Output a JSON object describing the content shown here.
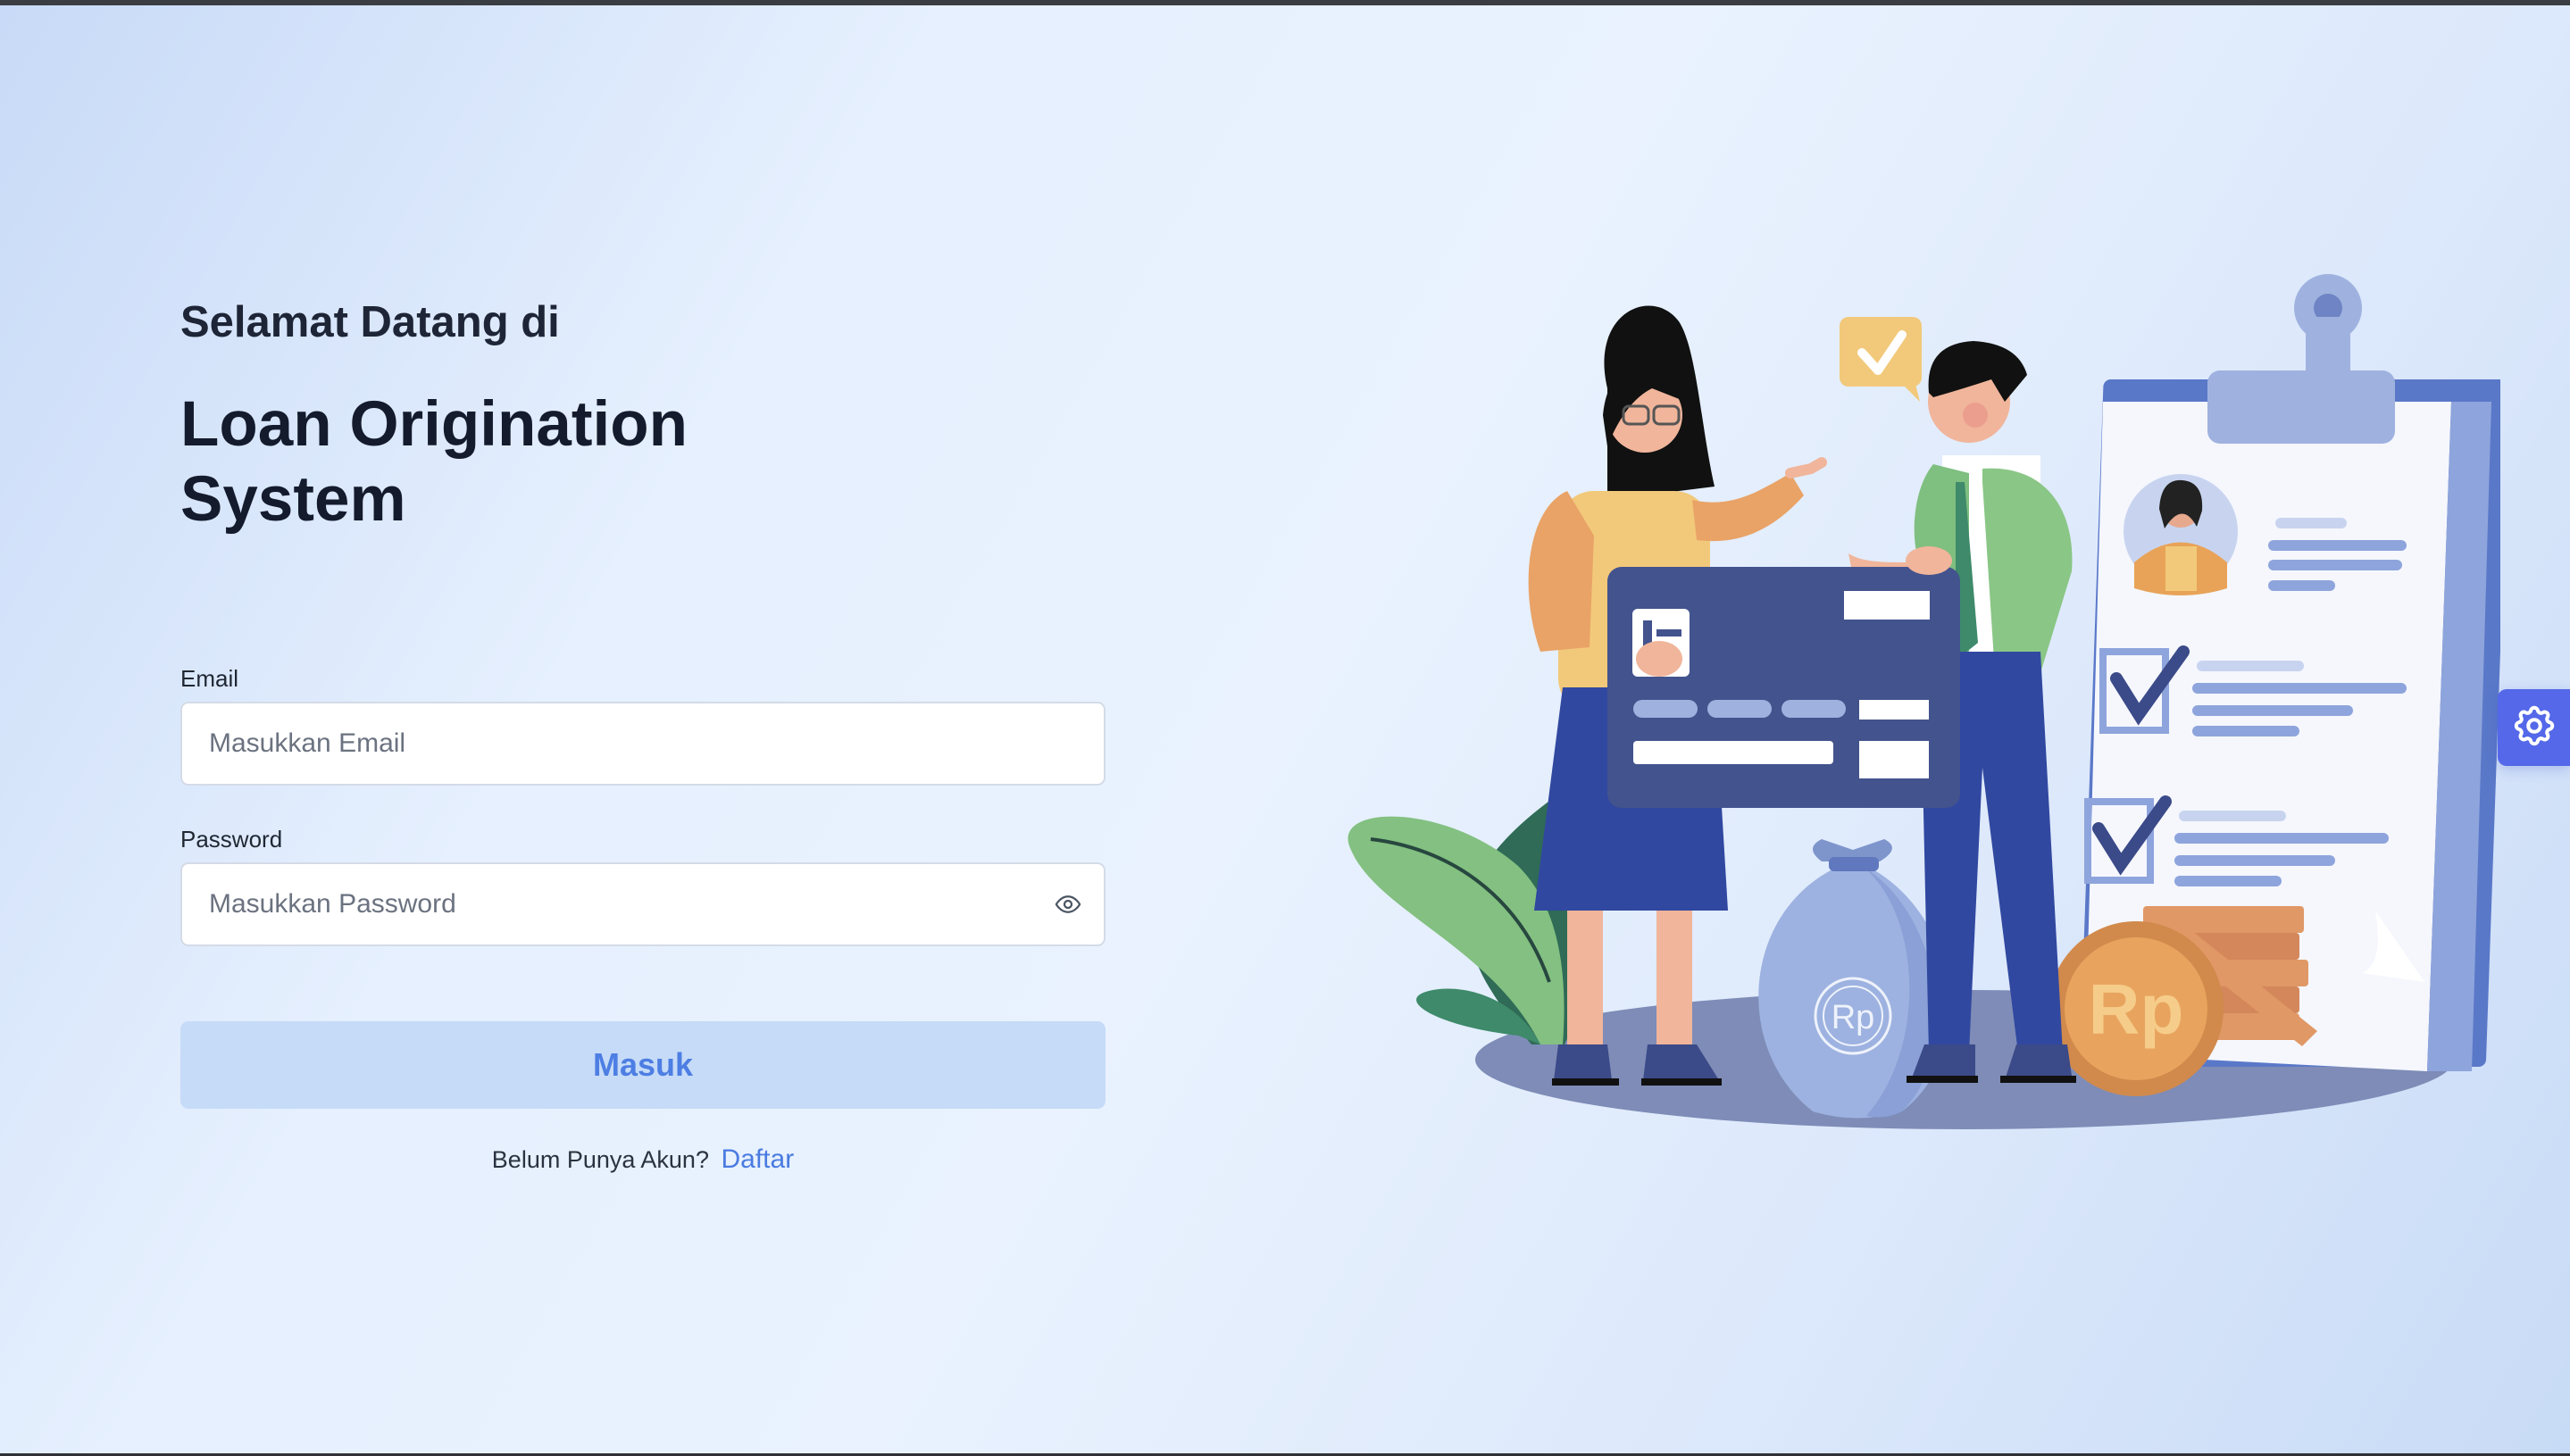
{
  "login": {
    "greeting": "Selamat Datang di",
    "title": "Loan Origination System",
    "email": {
      "label": "Email",
      "placeholder": "Masukkan Email",
      "value": ""
    },
    "password": {
      "label": "Password",
      "placeholder": "Masukkan Password",
      "value": "",
      "toggle_icon": "eye-icon"
    },
    "submit_label": "Masuk",
    "register_prompt": "Belum Punya Akun?",
    "register_link": "Daftar"
  },
  "illustration": {
    "currency_text": "Rp"
  },
  "settings": {
    "icon": "gear-icon"
  },
  "colors": {
    "primary": "#4d7ee3",
    "button_bg": "#c6dbf7",
    "settings_bg": "#5468e9",
    "title": "#141b2d"
  }
}
